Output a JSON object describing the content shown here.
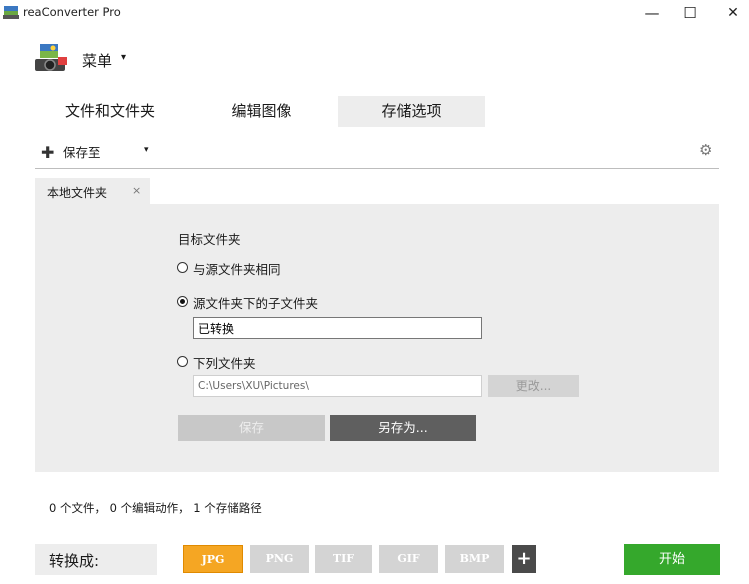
{
  "window": {
    "title": "reaConverter Pro",
    "minimize_glyph": "—",
    "maximize_glyph": "☐",
    "close_glyph": "✕"
  },
  "menu": {
    "label": "菜单",
    "caret": "▾"
  },
  "tabs": [
    {
      "label": "文件和文件夹"
    },
    {
      "label": "编辑图像"
    },
    {
      "label": "存储选项",
      "selected": true
    }
  ],
  "toolbar": {
    "add_glyph": "✚",
    "save_to_label": "保存至",
    "caret": "▾",
    "settings_icon": "gear-icon"
  },
  "inner_tab": {
    "label": "本地文件夹",
    "close_glyph": "×"
  },
  "form": {
    "heading": "目标文件夹",
    "options": [
      {
        "label": "与源文件夹相同",
        "checked": false
      },
      {
        "label": "源文件夹下的子文件夹",
        "checked": true
      },
      {
        "label": "下列文件夹",
        "checked": false
      }
    ],
    "subfolder_value": "已转换",
    "folder_path_value": "C:\\Users\\XU\\Pictures\\",
    "change_button": "更改...",
    "save_button": "保存",
    "save_as_button": "另存为..."
  },
  "status": {
    "text": "0 个文件， 0 个编辑动作， 1 个存储路径"
  },
  "bottom": {
    "convert_label": "转换成:",
    "formats": [
      {
        "label": "JPG",
        "selected": true
      },
      {
        "label": "PNG",
        "selected": false
      },
      {
        "label": "TIF",
        "selected": false
      },
      {
        "label": "GIF",
        "selected": false
      },
      {
        "label": "BMP",
        "selected": false
      }
    ],
    "add_glyph": "+",
    "start_button": "开始"
  },
  "colors": {
    "accent_selected_format": "#f5a623",
    "start_button": "#35a82c",
    "panel_background": "#ededed",
    "save_as_button": "#5f5f5f"
  }
}
